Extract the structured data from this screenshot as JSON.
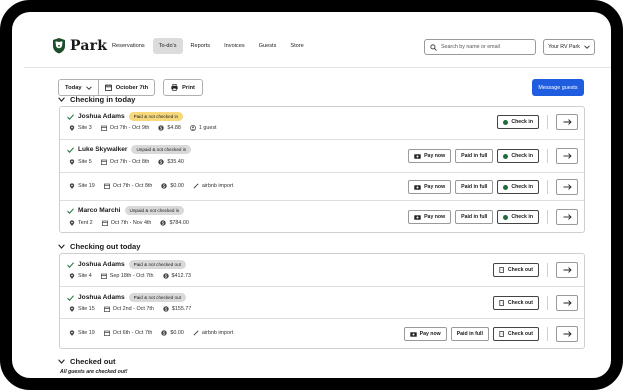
{
  "app": {
    "logo_text": "Park",
    "logo_icon": "bear-badge-icon"
  },
  "nav": {
    "items": [
      {
        "label": "Reservations"
      },
      {
        "label": "To-do's",
        "active": true
      },
      {
        "label": "Reports"
      },
      {
        "label": "Invoices"
      },
      {
        "label": "Guests"
      },
      {
        "label": "Store"
      }
    ],
    "search_placeholder": "Search by name or email",
    "park_select": "Your RV Park"
  },
  "toolbar": {
    "day_select": "Today",
    "date": "October 7th",
    "print_label": "Print",
    "message_guests_label": "Message guests",
    "accent_color": "#1f5de0"
  },
  "checking_in": {
    "title": "Checking in today",
    "rows": [
      {
        "checked": true,
        "name": "Joshua Adams",
        "badge": "Paid & not checked in",
        "badge_color": "yellow",
        "site": "Site 3",
        "dates": "Oct 7th - Oct 9th",
        "amount": "$4.88",
        "guests": "1 guest",
        "pay_now": "",
        "paid_in_full": "",
        "check_in": "Check in"
      },
      {
        "checked": true,
        "name": "Luke Skywalker",
        "badge": "Unpaid & not checked in",
        "badge_color": "gray",
        "site": "Site 5",
        "dates": "Oct 7th - Oct 8th",
        "amount": "$35.40",
        "pay_now": "Pay now",
        "paid_in_full": "Paid in full",
        "check_in": "Check in"
      },
      {
        "checked": false,
        "name": "",
        "badge": "",
        "site": "Site 19",
        "dates": "Oct 7th - Oct 8th",
        "amount": "$0.00",
        "import": "airbnb import",
        "pay_now": "Pay now",
        "paid_in_full": "Paid in full",
        "check_in": "Check in"
      },
      {
        "checked": true,
        "name": "Marco Marchi",
        "badge": "Unpaid & not checked in",
        "badge_color": "gray",
        "site": "Tent 2",
        "dates": "Oct 7th - Nov 4th",
        "amount": "$784.00",
        "pay_now": "Pay now",
        "paid_in_full": "Paid in full",
        "check_in": "Check in"
      }
    ]
  },
  "checking_out": {
    "title": "Checking out today",
    "rows": [
      {
        "checked": true,
        "name": "Joshua Adams",
        "badge": "Paid & not checked out",
        "site": "Site 4",
        "dates": "Sep 18th - Oct 7th",
        "amount": "$412.73",
        "check_out": "Check out"
      },
      {
        "checked": true,
        "name": "Joshua Adams",
        "badge": "Paid & not checked out",
        "site": "Site 15",
        "dates": "Oct 2nd - Oct 7th",
        "amount": "$155.77",
        "check_out": "Check out"
      },
      {
        "checked": false,
        "name": "",
        "badge": "",
        "site": "Site 19",
        "dates": "Oct 6th - Oct 7th",
        "amount": "$0.00",
        "import": "airbnb import",
        "pay_now": "Pay now",
        "paid_in_full": "Paid in full",
        "check_out": "Check out"
      }
    ]
  },
  "checked_out": {
    "title": "Checked out",
    "note": "All guests are checked out!"
  }
}
